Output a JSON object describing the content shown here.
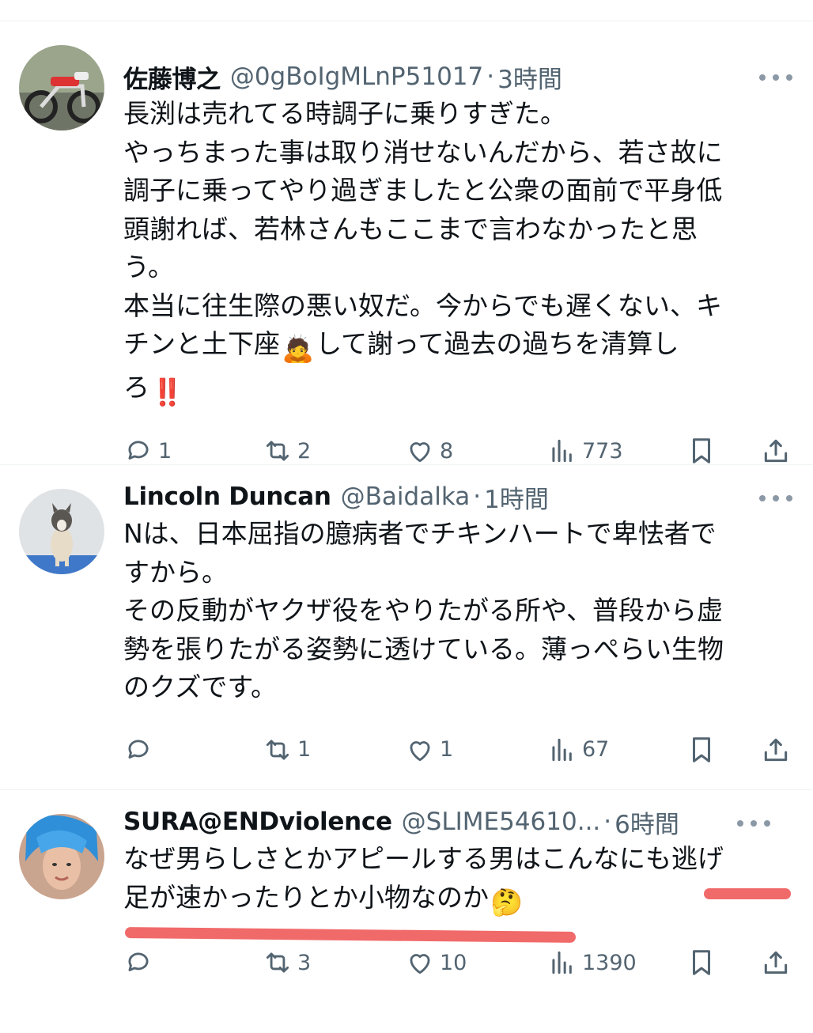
{
  "tweets": [
    {
      "name": "佐藤博之",
      "handle": "@0gBoIgMLnP51017",
      "time": "3時間",
      "lines": [
        "長渕は売れてる時調子に乗りすぎた。",
        "やっちまった事は取り消せないんだから、若さ故に",
        "調子に乗ってやり過ぎましたと公衆の面前で平身低",
        "頭謝れば、若林さんもここまで言わなかったと思",
        "う。",
        "本当に往生際の悪い奴だ。今からでも遅くない、キ",
        "チンと土下座",
        "して謝って過去の過ちを清算し",
        "ろ"
      ],
      "emoji": [
        "🙇",
        "‼️"
      ],
      "replies": "1",
      "retweets": "2",
      "likes": "8",
      "views": "773"
    },
    {
      "name": "Lincoln Duncan",
      "handle": "@Baidalka",
      "time": "1時間",
      "lines": [
        "Nは、日本屈指の臆病者でチキンハートで卑怯者で",
        "すから。",
        "その反動がヤクザ役をやりたがる所や、普段から虚",
        "勢を張りたがる姿勢に透けている。薄っぺらい生物",
        "のクズです。"
      ],
      "replies": "",
      "retweets": "1",
      "likes": "1",
      "views": "67"
    },
    {
      "name": "SURA@ENDviolence",
      "handle": "@SLIME54610...",
      "time": "6時間",
      "lines": [
        "なぜ男らしさとかアピールする男はこんなにも逃げ",
        "足が速かったりとか小物なのか"
      ],
      "emoji": [
        "🤔"
      ],
      "replies": "",
      "retweets": "3",
      "likes": "10",
      "views": "1390"
    }
  ],
  "separator": "·",
  "colors": {
    "underline": "#ef5a5a",
    "muted": "#536471"
  }
}
